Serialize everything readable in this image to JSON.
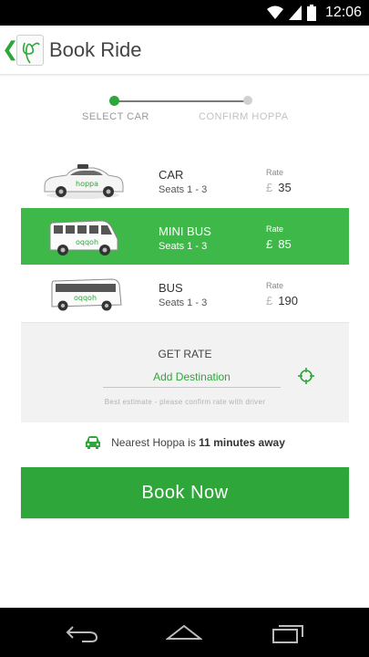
{
  "status_bar": {
    "time": "12:06",
    "icons": [
      "wifi-icon",
      "signal-icon",
      "battery-icon"
    ]
  },
  "app_bar": {
    "back_icon": "chevron-left-icon",
    "logo_icon": "hoppa-logo-icon",
    "title": "Book Ride"
  },
  "stepper": {
    "steps": [
      {
        "label": "SELECT CAR",
        "active": true
      },
      {
        "label": "CONFIRM HOPPA",
        "active": false
      }
    ]
  },
  "vehicles": [
    {
      "name": "CAR",
      "seats": "Seats 1 - 3",
      "rate_label": "Rate",
      "currency": "£",
      "price": "35",
      "selected": false,
      "icon": "car-image"
    },
    {
      "name": "MINI BUS",
      "seats": "Seats 1 - 3",
      "rate_label": "Rate",
      "currency": "£",
      "price": "85",
      "selected": true,
      "icon": "minibus-image"
    },
    {
      "name": "BUS",
      "seats": "Seats 1 - 3",
      "rate_label": "Rate",
      "currency": "£",
      "price": "190",
      "selected": false,
      "icon": "bus-image"
    }
  ],
  "rate_panel": {
    "title": "GET RATE",
    "destination_placeholder": "Add Destination",
    "locate_icon": "crosshair-icon",
    "note": "Best estimate - please confirm rate with driver"
  },
  "nearest": {
    "icon": "car-front-icon",
    "prefix": "Nearest Hoppa is",
    "time": "11 minutes away"
  },
  "book_button": {
    "label": "Book Now"
  },
  "nav_bar": {
    "icons": [
      "back-icon",
      "home-icon",
      "recents-icon"
    ]
  },
  "colors": {
    "accent": "#2ea63a",
    "selected_row": "#3fb84a",
    "panel_bg": "#f2f2f2"
  }
}
